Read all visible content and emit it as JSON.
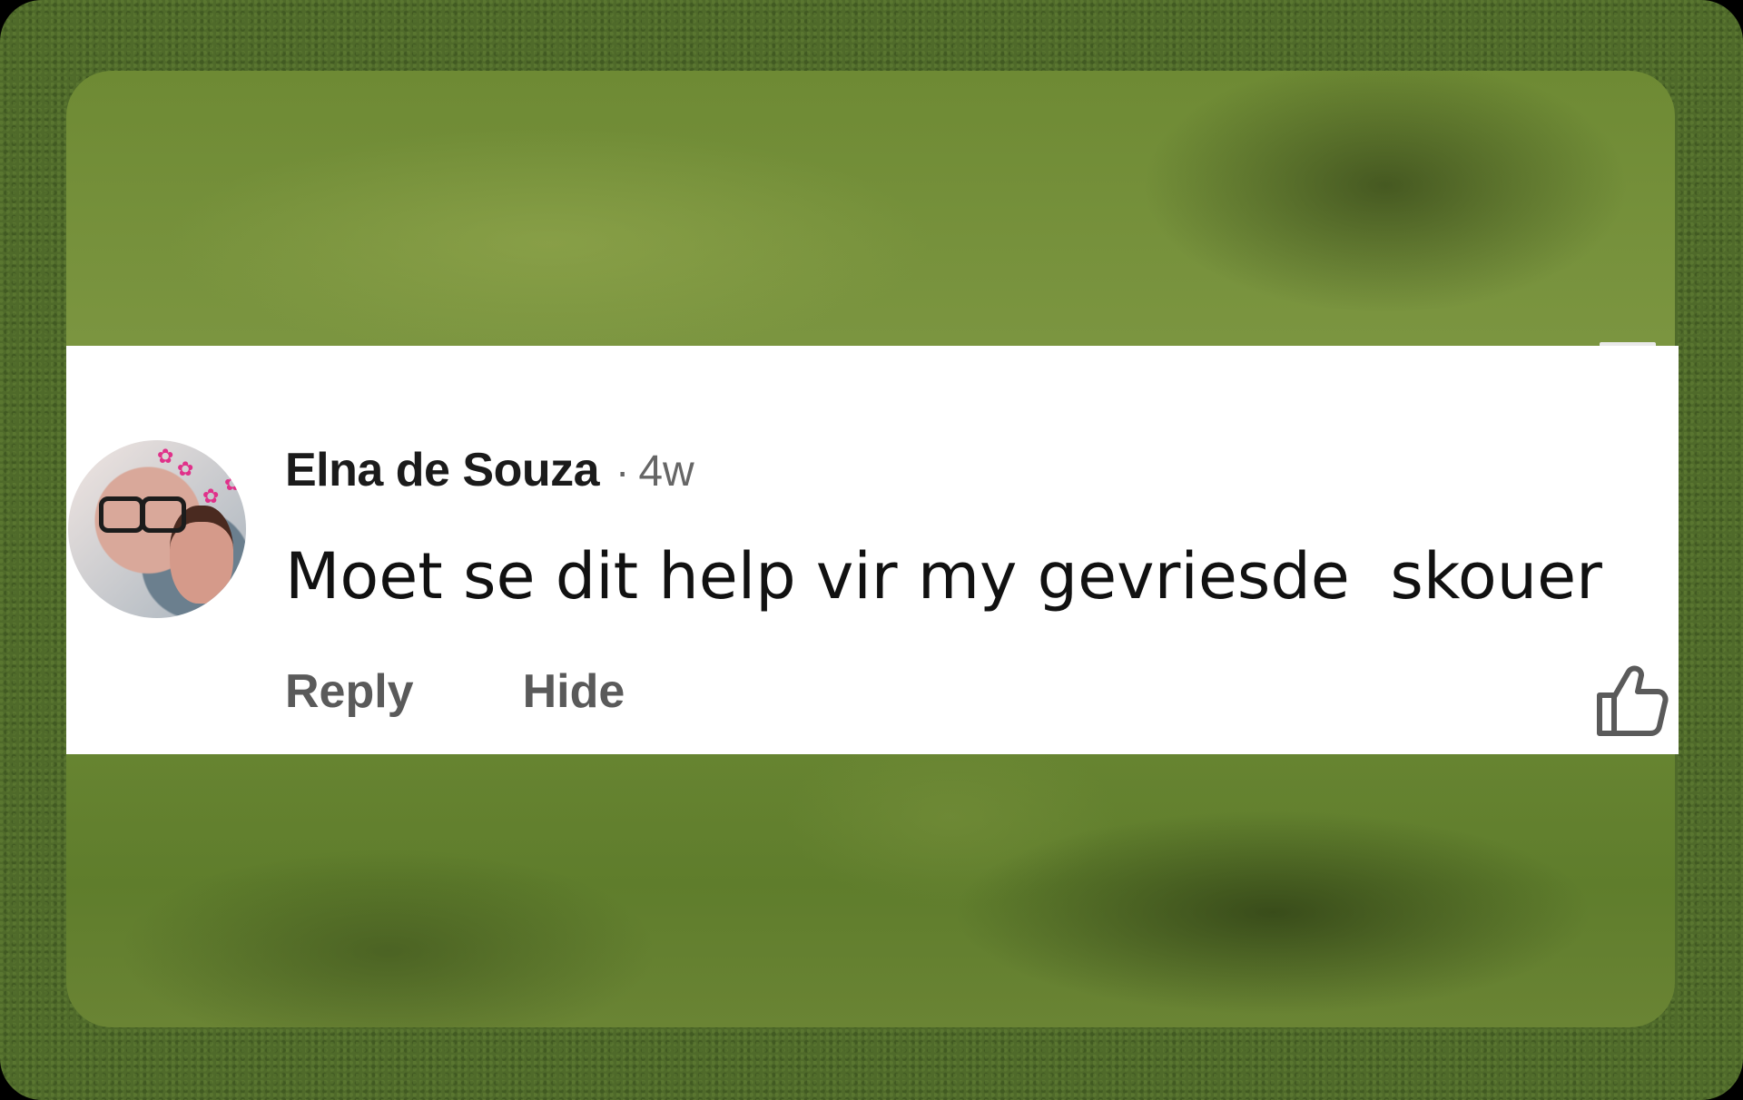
{
  "comment": {
    "author": "Elna de Souza",
    "separator": "·",
    "time": "4w",
    "text": "Moet se dit help vir my gevriesde  skouer"
  },
  "actions": {
    "reply_label": "Reply",
    "hide_label": "Hide"
  },
  "icons": {
    "like": "thumbs-up-icon",
    "avatar": "avatar"
  },
  "colors": {
    "background_green": "#4f6a2a",
    "card": "#ffffff",
    "text_primary": "#1b1b1b",
    "text_secondary": "#5a5a5a"
  }
}
